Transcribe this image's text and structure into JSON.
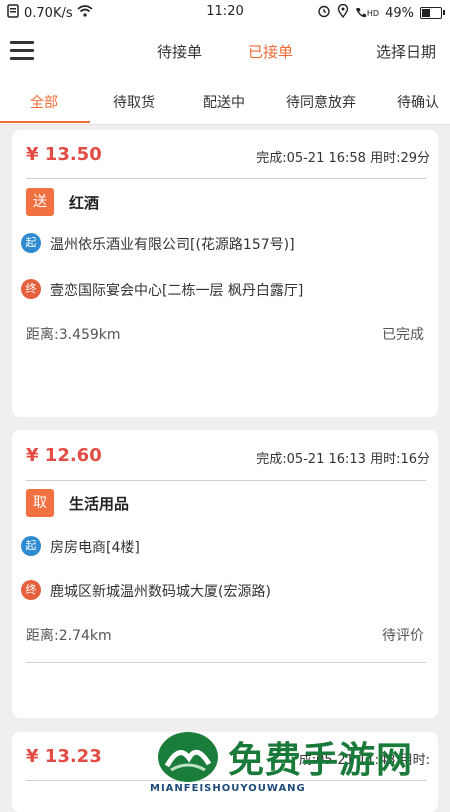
{
  "status_bar": {
    "speed": "0.70K/s",
    "time": "11:20",
    "hd_label": "HD",
    "battery": "49%",
    "battery_level": 0.49
  },
  "header": {
    "tabs": [
      {
        "label": "待接单",
        "active": false
      },
      {
        "label": "已接单",
        "active": true
      }
    ],
    "date_button": "选择日期"
  },
  "subtabs": [
    {
      "label": "全部",
      "active": true
    },
    {
      "label": "待取货",
      "active": false
    },
    {
      "label": "配送中",
      "active": false
    },
    {
      "label": "待同意放弃",
      "active": false
    },
    {
      "label": "待确认",
      "active": false
    }
  ],
  "orders": [
    {
      "price": "¥ 13.50",
      "meta": "完成:05-21 16:58 用时:29分",
      "badge": "送",
      "goods": "红酒",
      "start_icon": "起",
      "start": "温州依乐酒业有限公司[(花源路157号)]",
      "end_icon": "终",
      "end": "壹恋国际宴会中心[二栋一层 枫丹白露厅]",
      "distance": "距离:3.459km",
      "status": "已完成"
    },
    {
      "price": "¥ 12.60",
      "meta": "完成:05-21 16:13 用时:16分",
      "badge": "取",
      "goods": "生活用品",
      "start_icon": "起",
      "start": "房房电商[4楼]",
      "end_icon": "终",
      "end": "鹿城区新城温州数码城大厦(宏源路)",
      "distance": "距离:2.74km",
      "status": "待评价"
    },
    {
      "price": "¥ 13.23",
      "meta": "成:05-21 11:43 用时:"
    }
  ],
  "watermark": {
    "text_cn": "免费手游网",
    "text_en": "MIANFEISHOUYOUWANG"
  },
  "colors": {
    "accent": "#f06b38",
    "price": "#e34c44",
    "start_icon": "#2f8bd0",
    "end_icon": "#e5603d"
  }
}
